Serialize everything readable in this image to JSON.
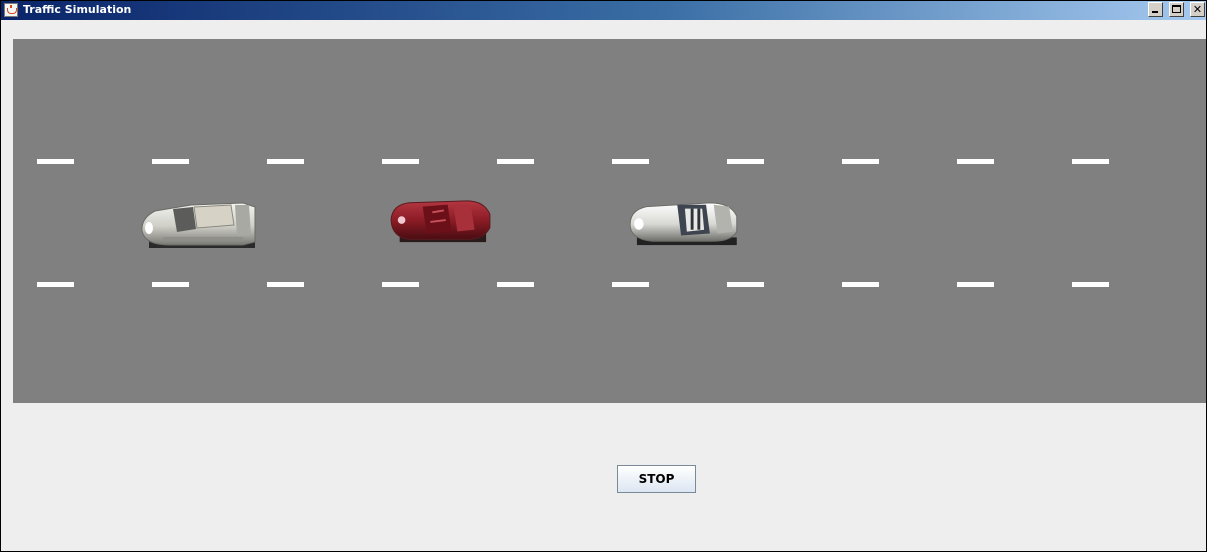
{
  "window": {
    "title": "Traffic Simulation",
    "controls": [
      "minimize",
      "maximize",
      "close"
    ]
  },
  "road": {
    "background": "#808080",
    "lane_marking_color": "#ffffff",
    "lane_marking_rows": 2,
    "dashes_per_row": 10,
    "cars": [
      {
        "name": "car-1",
        "color": "white/silver"
      },
      {
        "name": "car-2",
        "color": "dark red"
      },
      {
        "name": "car-3",
        "color": "white/silver"
      }
    ]
  },
  "controls": {
    "stop_label": "STOP"
  },
  "colors": {
    "titlebar_start": "#0a246a",
    "titlebar_end": "#a6caf0",
    "panel": "#eeeeee"
  }
}
